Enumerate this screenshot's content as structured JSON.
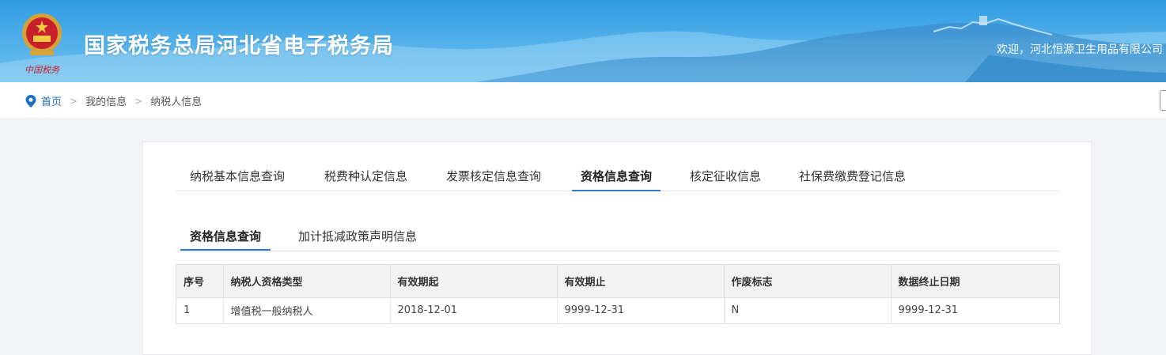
{
  "header": {
    "site_title": "国家税务总局河北省电子税务局",
    "emblem_caption": "中国税务",
    "welcome_text": "欢迎，河北恒源卫生用品有限公司"
  },
  "breadcrumb": {
    "items": [
      "首页",
      "我的信息",
      "纳税人信息"
    ],
    "separator": ">"
  },
  "main_tabs": [
    {
      "label": "纳税基本信息查询",
      "active": false
    },
    {
      "label": "税费种认定信息",
      "active": false
    },
    {
      "label": "发票核定信息查询",
      "active": false
    },
    {
      "label": "资格信息查询",
      "active": true
    },
    {
      "label": "核定征收信息",
      "active": false
    },
    {
      "label": "社保费缴费登记信息",
      "active": false
    }
  ],
  "sub_tabs": [
    {
      "label": "资格信息查询",
      "active": true
    },
    {
      "label": "加计抵减政策声明信息",
      "active": false
    }
  ],
  "table": {
    "columns": [
      "序号",
      "纳税人资格类型",
      "有效期起",
      "有效期止",
      "作废标志",
      "数据终止日期"
    ],
    "rows": [
      [
        "1",
        "增值税一般纳税人",
        "2018-12-01",
        "9999-12-31",
        "N",
        "9999-12-31"
      ]
    ]
  },
  "colors": {
    "accent": "#2d7bd6",
    "header_top": "#2f9be2",
    "link": "#1f6fc5"
  },
  "icons": {
    "emblem": "tax-emblem-icon",
    "location": "location-pin-icon"
  }
}
